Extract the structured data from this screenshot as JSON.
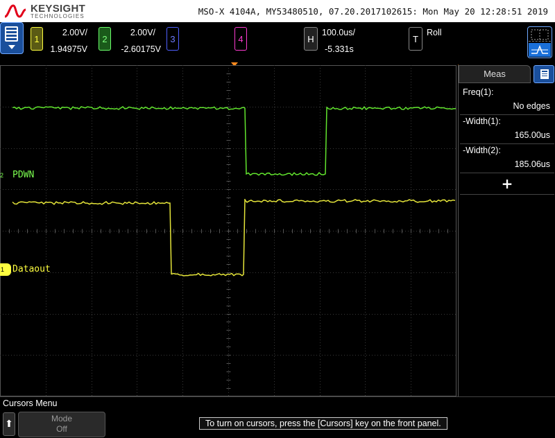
{
  "header": {
    "brand": "KEYSIGHT",
    "brand_sub": "TECHNOLOGIES",
    "instrument_info": "MSO-X 4104A, MY53480510, 07.20.2017102615: Mon May 20 12:28:51 2019"
  },
  "channels": [
    {
      "num": "1",
      "scale": "2.00V/",
      "offset": "1.94975V",
      "color": "#ffff40"
    },
    {
      "num": "2",
      "scale": "2.00V/",
      "offset": "-2.60175V",
      "color": "#7cff50"
    },
    {
      "num": "3",
      "color": "#5060ff"
    },
    {
      "num": "4",
      "color": "#ff3cd2"
    }
  ],
  "horizontal": {
    "label": "H",
    "scale": "100.0us/",
    "delay": "-5.331s"
  },
  "trigger": {
    "label": "T",
    "mode": "Roll"
  },
  "traces": {
    "ch2_label": "PDWN",
    "ch1_label": "Dataout",
    "ch2_gnd": "2",
    "ch1_gnd": "1"
  },
  "meas": {
    "tab_label": "Meas",
    "items": [
      {
        "name": "Freq(1):",
        "value": "No edges"
      },
      {
        "name": "-Width(1):",
        "value": "165.00us"
      },
      {
        "name": "-Width(2):",
        "value": "185.06us"
      }
    ],
    "add_label": "+"
  },
  "bottom": {
    "menu_title": "Cursors Menu",
    "back_symbol": "⬆",
    "mode_label": "Mode",
    "mode_value": "Off",
    "hint": "To turn on cursors, press the [Cursors] key on the front panel."
  }
}
